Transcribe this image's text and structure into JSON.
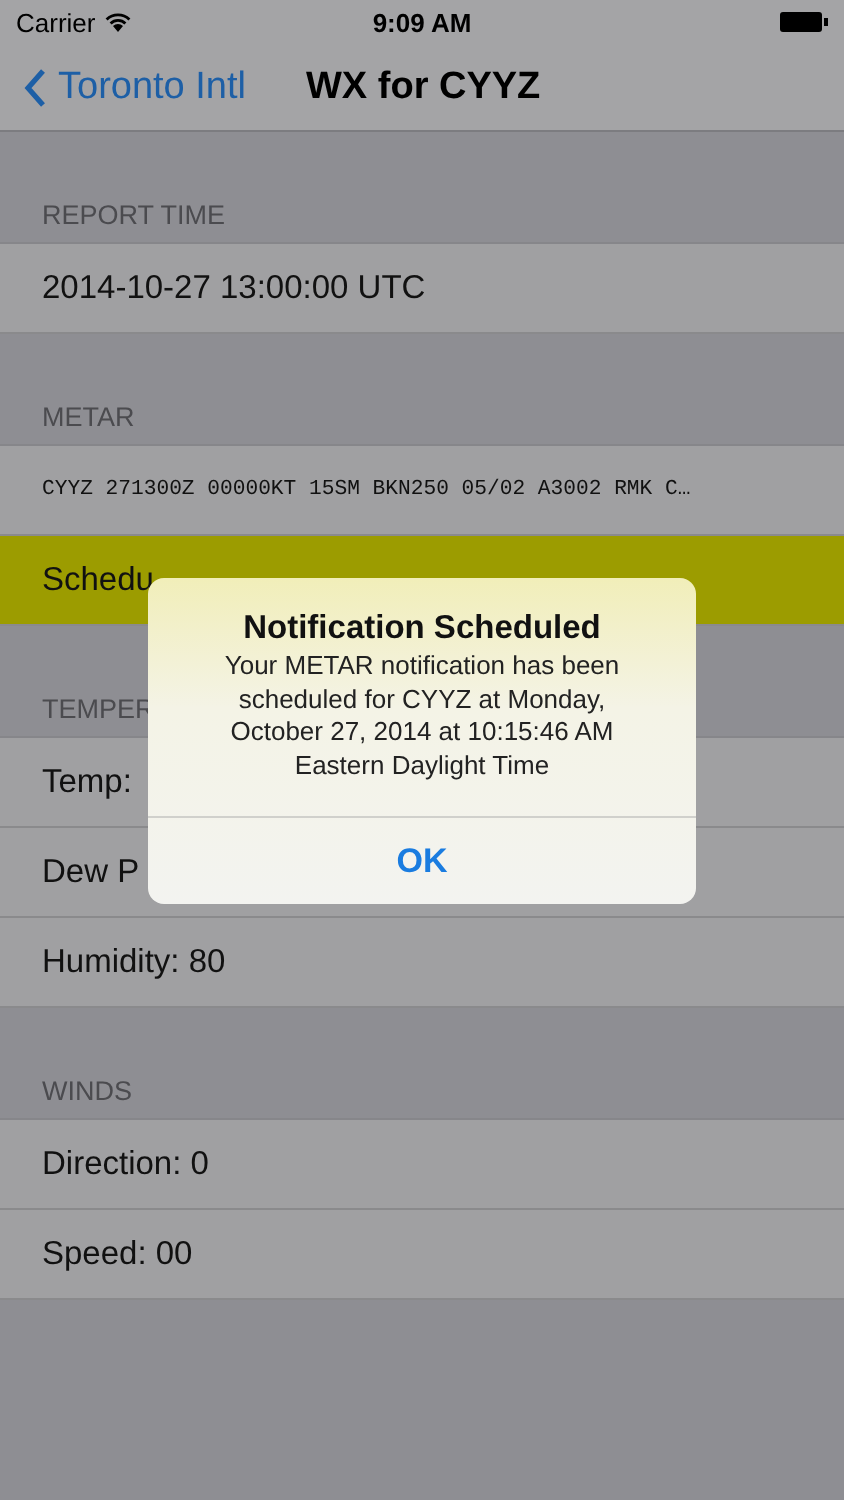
{
  "status_bar": {
    "carrier": "Carrier",
    "time": "9:09 AM"
  },
  "nav_bar": {
    "back": "Toronto Intl",
    "title": "WX for CYYZ"
  },
  "sections": [
    {
      "header": "REPORT TIME",
      "rows": [
        {
          "kind": "plain",
          "text": "2014-10-27 13:00:00 UTC",
          "highlighted": false
        }
      ]
    },
    {
      "header": "METAR",
      "rows": [
        {
          "kind": "mono",
          "text": "CYYZ 271300Z 00000KT 15SM BKN250 05/02 A3002 RMK C…",
          "highlighted": false
        },
        {
          "kind": "action",
          "text": "Schedu",
          "highlighted": true
        }
      ]
    },
    {
      "header": "TEMPER",
      "rows": [
        {
          "kind": "plain",
          "text": "Temp:",
          "highlighted": false
        },
        {
          "kind": "plain",
          "text": "Dew P",
          "highlighted": false
        },
        {
          "kind": "plain",
          "text": "Humidity: 80",
          "highlighted": false
        }
      ]
    },
    {
      "header": "WINDS",
      "rows": [
        {
          "kind": "plain",
          "text": "Direction: 0",
          "highlighted": false
        },
        {
          "kind": "plain",
          "text": "Speed: 00",
          "highlighted": false
        }
      ]
    }
  ],
  "alert": {
    "title": "Notification Scheduled",
    "message": "Your METAR notification has been scheduled for CYYZ at Monday, October 27, 2014 at 10:15:46 AM Eastern Daylight Time",
    "button": "OK"
  }
}
